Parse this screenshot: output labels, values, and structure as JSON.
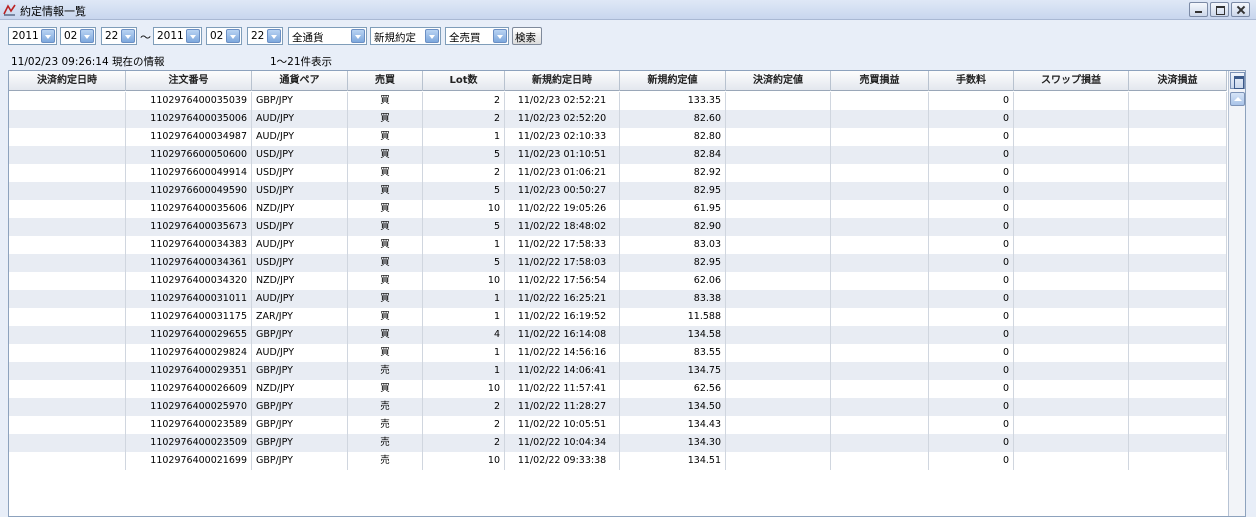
{
  "window": {
    "title": "約定情報一覧"
  },
  "filters": {
    "from_year": "2011",
    "from_month": "02",
    "from_day": "22",
    "range_sep": "～",
    "to_year": "2011",
    "to_month": "02",
    "to_day": "22",
    "currency": "全通貨",
    "trade_type": "新規約定",
    "side": "全売買",
    "search_label": "検索"
  },
  "status": {
    "timestamp_info": "11/02/23 09:26:14 現在の情報",
    "count_info": "1～21件表示"
  },
  "columns": [
    "決済約定日時",
    "注文番号",
    "通貨ペア",
    "売買",
    "Lot数",
    "新規約定日時",
    "新規約定値",
    "決済約定値",
    "売買損益",
    "手数料",
    "スワップ損益",
    "決済損益"
  ],
  "rows": [
    [
      "",
      "1102976400035039",
      "GBP/JPY",
      "買",
      "2",
      "11/02/23 02:52:21",
      "133.35",
      "",
      "",
      "0",
      "",
      ""
    ],
    [
      "",
      "1102976400035006",
      "AUD/JPY",
      "買",
      "2",
      "11/02/23 02:52:20",
      "82.60",
      "",
      "",
      "0",
      "",
      ""
    ],
    [
      "",
      "1102976400034987",
      "AUD/JPY",
      "買",
      "1",
      "11/02/23 02:10:33",
      "82.80",
      "",
      "",
      "0",
      "",
      ""
    ],
    [
      "",
      "1102976600050600",
      "USD/JPY",
      "買",
      "5",
      "11/02/23 01:10:51",
      "82.84",
      "",
      "",
      "0",
      "",
      ""
    ],
    [
      "",
      "1102976600049914",
      "USD/JPY",
      "買",
      "2",
      "11/02/23 01:06:21",
      "82.92",
      "",
      "",
      "0",
      "",
      ""
    ],
    [
      "",
      "1102976600049590",
      "USD/JPY",
      "買",
      "5",
      "11/02/23 00:50:27",
      "82.95",
      "",
      "",
      "0",
      "",
      ""
    ],
    [
      "",
      "1102976400035606",
      "NZD/JPY",
      "買",
      "10",
      "11/02/22 19:05:26",
      "61.95",
      "",
      "",
      "0",
      "",
      ""
    ],
    [
      "",
      "1102976400035673",
      "USD/JPY",
      "買",
      "5",
      "11/02/22 18:48:02",
      "82.90",
      "",
      "",
      "0",
      "",
      ""
    ],
    [
      "",
      "1102976400034383",
      "AUD/JPY",
      "買",
      "1",
      "11/02/22 17:58:33",
      "83.03",
      "",
      "",
      "0",
      "",
      ""
    ],
    [
      "",
      "1102976400034361",
      "USD/JPY",
      "買",
      "5",
      "11/02/22 17:58:03",
      "82.95",
      "",
      "",
      "0",
      "",
      ""
    ],
    [
      "",
      "1102976400034320",
      "NZD/JPY",
      "買",
      "10",
      "11/02/22 17:56:54",
      "62.06",
      "",
      "",
      "0",
      "",
      ""
    ],
    [
      "",
      "1102976400031011",
      "AUD/JPY",
      "買",
      "1",
      "11/02/22 16:25:21",
      "83.38",
      "",
      "",
      "0",
      "",
      ""
    ],
    [
      "",
      "1102976400031175",
      "ZAR/JPY",
      "買",
      "1",
      "11/02/22 16:19:52",
      "11.588",
      "",
      "",
      "0",
      "",
      ""
    ],
    [
      "",
      "1102976400029655",
      "GBP/JPY",
      "買",
      "4",
      "11/02/22 16:14:08",
      "134.58",
      "",
      "",
      "0",
      "",
      ""
    ],
    [
      "",
      "1102976400029824",
      "AUD/JPY",
      "買",
      "1",
      "11/02/22 14:56:16",
      "83.55",
      "",
      "",
      "0",
      "",
      ""
    ],
    [
      "",
      "1102976400029351",
      "GBP/JPY",
      "売",
      "1",
      "11/02/22 14:06:41",
      "134.75",
      "",
      "",
      "0",
      "",
      ""
    ],
    [
      "",
      "1102976400026609",
      "NZD/JPY",
      "買",
      "10",
      "11/02/22 11:57:41",
      "62.56",
      "",
      "",
      "0",
      "",
      ""
    ],
    [
      "",
      "1102976400025970",
      "GBP/JPY",
      "売",
      "2",
      "11/02/22 11:28:27",
      "134.50",
      "",
      "",
      "0",
      "",
      ""
    ],
    [
      "",
      "1102976400023589",
      "GBP/JPY",
      "売",
      "2",
      "11/02/22 10:05:51",
      "134.43",
      "",
      "",
      "0",
      "",
      ""
    ],
    [
      "",
      "1102976400023509",
      "GBP/JPY",
      "売",
      "2",
      "11/02/22 10:04:34",
      "134.30",
      "",
      "",
      "0",
      "",
      ""
    ],
    [
      "",
      "1102976400021699",
      "GBP/JPY",
      "売",
      "10",
      "11/02/22 09:33:38",
      "134.51",
      "",
      "",
      "0",
      "",
      ""
    ]
  ]
}
